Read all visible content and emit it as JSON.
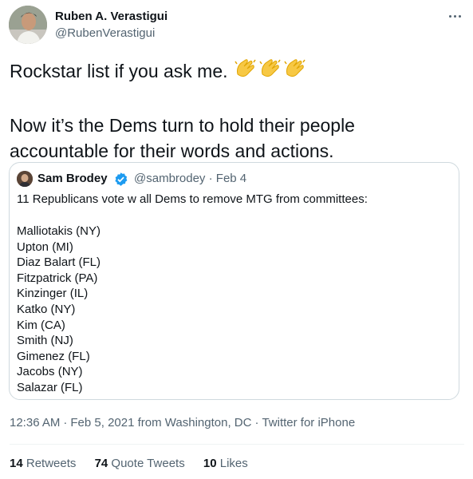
{
  "author": {
    "name": "Ruben A. Verastigui",
    "handle": "@RubenVerastigui"
  },
  "tweet": {
    "line1": "Rockstar list if you ask me.",
    "line2": "Now it’s the Dems turn to hold their people",
    "line3": "accountable for their words and actions.",
    "emoji": "clapping-hands-x3"
  },
  "quote": {
    "name": "Sam Brodey",
    "handle": "@sambrodey",
    "separator": "·",
    "date": "Feb 4",
    "intro": "11 Republicans vote w all Dems to remove MTG from committees:",
    "members": [
      "Malliotakis (NY)",
      "Upton (MI)",
      "Diaz Balart (FL)",
      "Fitzpatrick (PA)",
      "Kinzinger (IL)",
      "Katko (NY)",
      "Kim (CA)",
      "Smith (NJ)",
      "Gimenez (FL)",
      "Jacobs (NY)",
      "Salazar (FL)"
    ]
  },
  "meta": {
    "time": "12:36 AM",
    "date": "Feb 5, 2021 from Washington, DC",
    "client": "Twitter for iPhone",
    "separator": "·"
  },
  "stats": {
    "retweets_count": "14",
    "retweets_label": "Retweets",
    "quotes_count": "74",
    "quotes_label": "Quote Tweets",
    "likes_count": "10",
    "likes_label": "Likes"
  },
  "colors": {
    "text": "#0f1419",
    "secondary": "#536471",
    "border": "#cfd9de",
    "verified": "#1d9bf0",
    "clap": "#f7c844"
  }
}
